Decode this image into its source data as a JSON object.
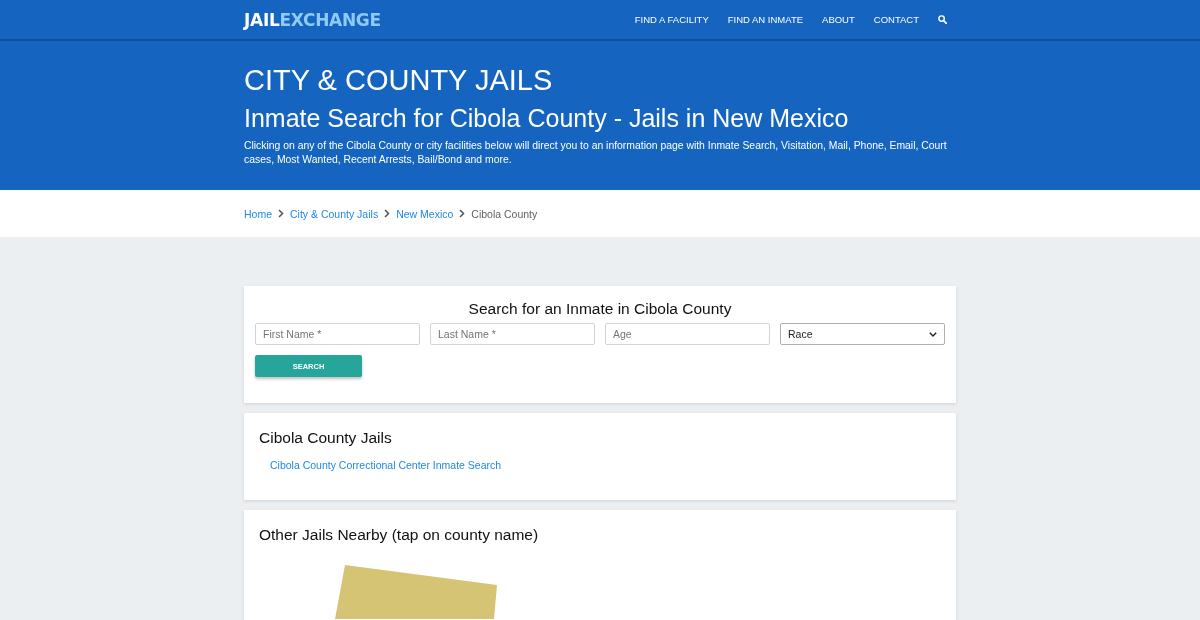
{
  "header": {
    "logo": {
      "primary": "JAIL",
      "accent": "EXCHANGE"
    },
    "nav": [
      "FIND A FACILITY",
      "FIND AN INMATE",
      "ABOUT",
      "CONTACT"
    ]
  },
  "hero": {
    "title": "CITY & COUNTY JAILS",
    "subtitle": "Inmate Search for Cibola County - Jails in New Mexico",
    "description": "Clicking on any of the Cibola County or city facilities below will direct you to an information page with Inmate Search, Visitation, Mail, Phone, Email, Court cases, Most Wanted, Recent Arrests, Bail/Bond and more."
  },
  "breadcrumb": [
    {
      "label": "Home",
      "current": false
    },
    {
      "label": "City & County Jails",
      "current": false
    },
    {
      "label": "New Mexico",
      "current": false
    },
    {
      "label": "Cibola County",
      "current": true
    }
  ],
  "search_form": {
    "title": "Search for an Inmate in Cibola County",
    "fields": [
      {
        "kind": "text",
        "placeholder": "First Name *"
      },
      {
        "kind": "text",
        "placeholder": "Last Name *"
      },
      {
        "kind": "text",
        "placeholder": "Age"
      },
      {
        "kind": "select",
        "value": "Race"
      }
    ],
    "button": "SEARCH"
  },
  "jails_card": {
    "title": "Cibola County Jails",
    "links": [
      "Cibola County Correctional Center Inmate Search"
    ]
  },
  "nearby_card": {
    "title": "Other Jails Nearby (tap on county name)"
  }
}
